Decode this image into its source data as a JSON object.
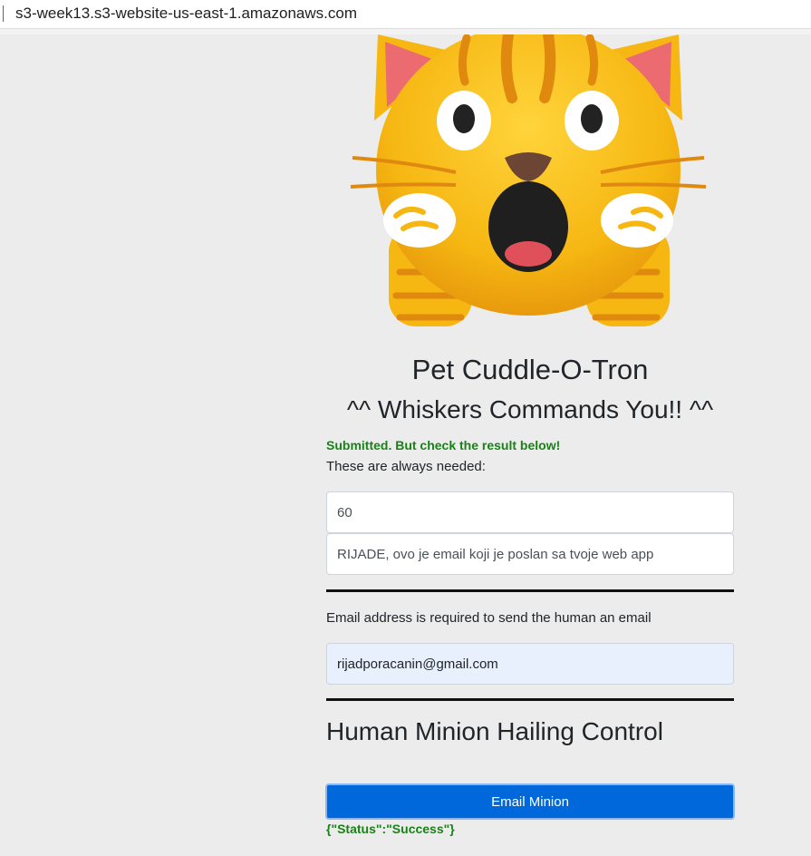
{
  "browser": {
    "url": "s3-week13.s3-website-us-east-1.amazonaws.com"
  },
  "hero": {
    "image": "shocked-cat-emoji"
  },
  "header": {
    "title": "Pet Cuddle-O-Tron",
    "subtitle": "^^ Whiskers Commands You!! ^^"
  },
  "form": {
    "status_message": "Submitted. But check the result below!",
    "needed_label": "These are always needed:",
    "minutes_value": "60",
    "message_value": "RIJADE, ovo je email koji je poslan sa tvoje web app",
    "email_note": "Email address is required to send the human an email",
    "email_value": "rijadporacanin@gmail.com"
  },
  "control": {
    "section_title": "Human Minion Hailing Control",
    "email_button_label": "Email Minion",
    "result": "{\"Status\":\"Success\"}"
  },
  "colors": {
    "page_background": "#ececec",
    "success_text": "#198217",
    "button_background": "#0068da",
    "autofill_background": "#e8f0fe",
    "cat_fur": "#f6b712",
    "cat_stripes": "#e0890f"
  }
}
